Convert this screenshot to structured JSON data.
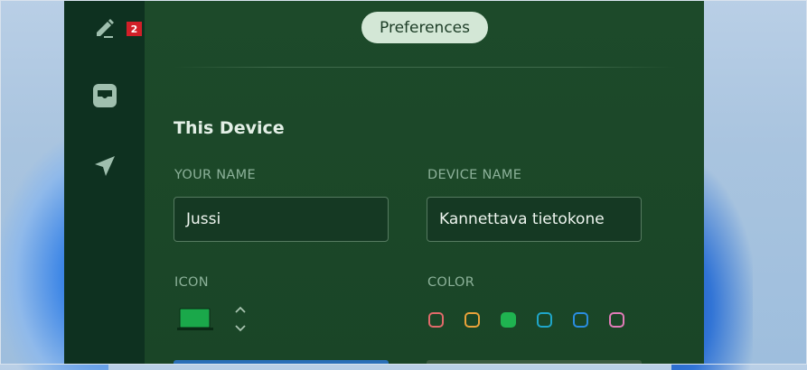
{
  "sidebar": {
    "items": [
      {
        "name": "compose",
        "icon": "pencil-icon",
        "badge": "2"
      },
      {
        "name": "inbox",
        "icon": "inbox-icon"
      },
      {
        "name": "send",
        "icon": "send-icon"
      }
    ]
  },
  "header": {
    "pill_label": "Preferences"
  },
  "section": {
    "title": "This Device"
  },
  "fields": {
    "your_name_label": "YOUR NAME",
    "your_name_value": "Jussi",
    "device_name_label": "DEVICE NAME",
    "device_name_value": "Kannettava tietokone"
  },
  "icon_picker": {
    "label": "ICON",
    "selected": "laptop-icon",
    "color": "#1aa84a"
  },
  "color_picker": {
    "label": "COLOR",
    "options": [
      {
        "name": "red",
        "hex": "#e06a6a",
        "selected": false
      },
      {
        "name": "orange",
        "hex": "#e9a23a",
        "selected": false
      },
      {
        "name": "green",
        "hex": "#1fb350",
        "selected": true
      },
      {
        "name": "cyan",
        "hex": "#1fa6c9",
        "selected": false
      },
      {
        "name": "blue",
        "hex": "#2a8de0",
        "selected": false
      },
      {
        "name": "pink",
        "hex": "#e07bb8",
        "selected": false
      }
    ]
  }
}
